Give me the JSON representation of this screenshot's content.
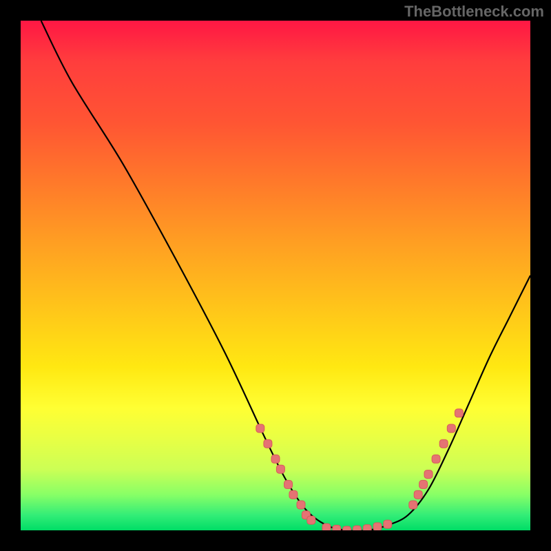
{
  "watermark": "TheBottleneck.com",
  "chart_data": {
    "type": "line",
    "title": "",
    "xlabel": "",
    "ylabel": "",
    "xlim": [
      0,
      100
    ],
    "ylim": [
      0,
      100
    ],
    "series": [
      {
        "name": "curve",
        "x": [
          4,
          10,
          20,
          30,
          40,
          48,
          52,
          56,
          60,
          64,
          68,
          72,
          76,
          80,
          84,
          88,
          92,
          96,
          100
        ],
        "y": [
          100,
          88,
          72,
          54,
          35,
          18,
          10,
          4,
          1,
          0,
          0,
          1,
          3,
          8,
          16,
          25,
          34,
          42,
          50
        ]
      }
    ],
    "markers": {
      "left_cluster": {
        "x": [
          47,
          48.5,
          50,
          51,
          52.5,
          53.5,
          55,
          56,
          57
        ],
        "y": [
          20,
          17,
          14,
          12,
          9,
          7,
          5,
          3,
          2
        ]
      },
      "bottom_cluster": {
        "x": [
          60,
          62,
          64,
          66,
          68,
          70,
          72
        ],
        "y": [
          0.5,
          0.2,
          0,
          0.1,
          0.3,
          0.7,
          1.2
        ]
      },
      "right_cluster": {
        "x": [
          77,
          78,
          79,
          80,
          81.5,
          83,
          84.5,
          86
        ],
        "y": [
          5,
          7,
          9,
          11,
          14,
          17,
          20,
          23
        ]
      }
    },
    "background_gradient": {
      "top": "#ff1744",
      "mid": "#ffe812",
      "bottom": "#00dd66"
    }
  }
}
